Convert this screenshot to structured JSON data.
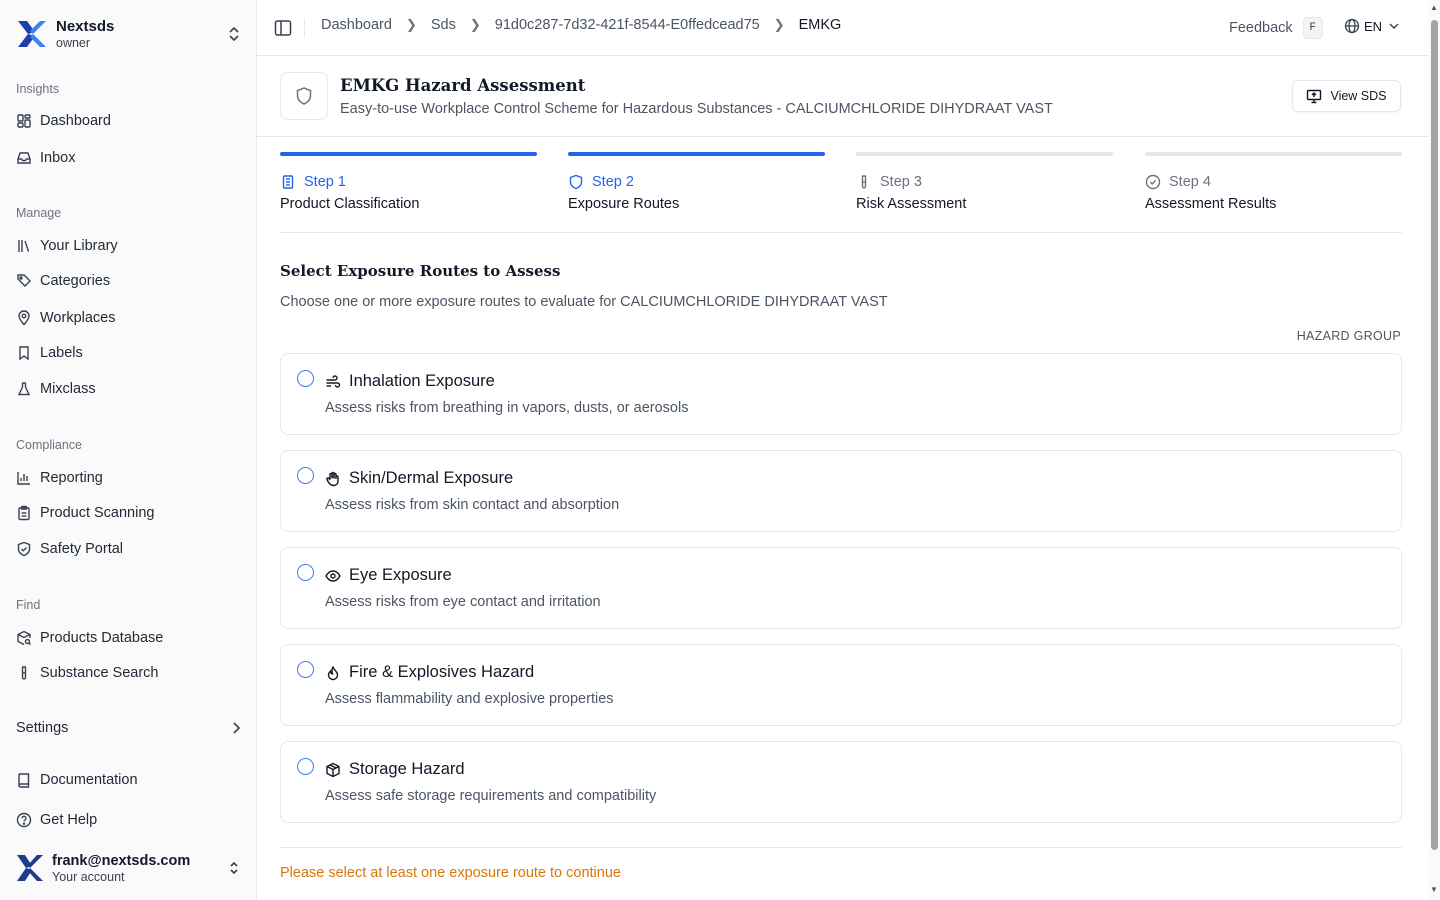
{
  "sidebar": {
    "org": {
      "name": "Nextsds",
      "role": "owner"
    },
    "sections": {
      "insights": "Insights",
      "manage": "Manage",
      "compliance": "Compliance",
      "find": "Find"
    },
    "items": {
      "dashboard": "Dashboard",
      "inbox": "Inbox",
      "library": "Your Library",
      "categories": "Categories",
      "workplaces": "Workplaces",
      "labels": "Labels",
      "mixclass": "Mixclass",
      "reporting": "Reporting",
      "product_scanning": "Product Scanning",
      "safety_portal": "Safety Portal",
      "products_database": "Products Database",
      "substance_search": "Substance Search",
      "settings": "Settings",
      "documentation": "Documentation",
      "get_help": "Get Help"
    },
    "account": {
      "email": "frank@nextsds.com",
      "subtitle": "Your account"
    }
  },
  "topbar": {
    "breadcrumb": [
      "Dashboard",
      "Sds",
      "91d0c287-7d32-421f-8544-E0ffedcead75",
      "EMKG"
    ],
    "feedback": "Feedback",
    "feedback_shortcut": "F",
    "language": "EN"
  },
  "header": {
    "title": "EMKG Hazard Assessment",
    "subtitle": "Easy-to-use Workplace Control Scheme for Hazardous Substances - CALCIUMCHLORIDE DIHYDRAAT VAST",
    "view_sds": "View SDS"
  },
  "steps": [
    {
      "label": "Step 1",
      "name": "Product Classification",
      "status": "complete"
    },
    {
      "label": "Step 2",
      "name": "Exposure Routes",
      "status": "active"
    },
    {
      "label": "Step 3",
      "name": "Risk Assessment",
      "status": "pending"
    },
    {
      "label": "Step 4",
      "name": "Assessment Results",
      "status": "pending"
    }
  ],
  "content": {
    "title": "Select Exposure Routes to Assess",
    "subtitle": "Choose one or more exposure routes to evaluate for CALCIUMCHLORIDE DIHYDRAAT VAST",
    "hazard_group": "HAZARD GROUP",
    "routes": [
      {
        "title": "Inhalation Exposure",
        "desc": "Assess risks from breathing in vapors, dusts, or aerosols",
        "icon": "wind-icon",
        "selected": false
      },
      {
        "title": "Skin/Dermal Exposure",
        "desc": "Assess risks from skin contact and absorption",
        "icon": "hand-icon",
        "selected": false
      },
      {
        "title": "Eye Exposure",
        "desc": "Assess risks from eye contact and irritation",
        "icon": "eye-icon",
        "selected": false
      },
      {
        "title": "Fire & Explosives Hazard",
        "desc": "Assess flammability and explosive properties",
        "icon": "flame-icon",
        "selected": false
      },
      {
        "title": "Storage Hazard",
        "desc": "Assess safe storage requirements and compatibility",
        "icon": "package-icon",
        "selected": false
      }
    ],
    "warning": "Please select at least one exposure route to continue"
  },
  "colors": {
    "accent": "#2563eb",
    "warning": "#d97706",
    "border": "#e5e7eb",
    "brand_logo": "#1e3a8a"
  }
}
